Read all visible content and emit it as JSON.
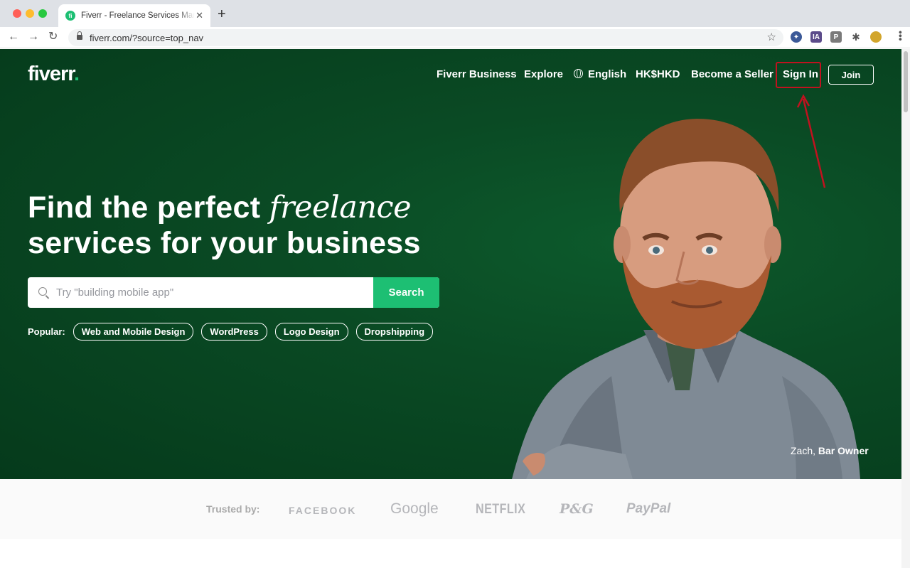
{
  "browser": {
    "tab_title": "Fiverr - Freelance Services Marketplace",
    "tab_favicon": "fi",
    "url": "fiverr.com/?source=top_nav",
    "extensions": [
      {
        "name": "vpn-extension-icon",
        "label": "",
        "color": "#3b5998"
      },
      {
        "name": "ia-extension-icon",
        "label": "IA",
        "color": "#5b4b8a"
      },
      {
        "name": "p-extension-icon",
        "label": "P",
        "color": "#7a7a7a"
      }
    ]
  },
  "nav": {
    "logo": "fiverr",
    "logo_dot": ".",
    "links": {
      "business": "Fiverr Business",
      "explore": "Explore",
      "language": "English",
      "currency": "HK$HKD",
      "seller": "Become a Seller",
      "signin": "Sign In",
      "join": "Join"
    }
  },
  "hero": {
    "headline_part1": "Find the perfect ",
    "headline_italic": "freelance",
    "headline_line2": "services for your business",
    "search_placeholder": "Try \"building mobile app\"",
    "search_button": "Search",
    "popular_label": "Popular:",
    "popular_tags": [
      "Web and Mobile Design",
      "WordPress",
      "Logo Design",
      "Dropshipping"
    ],
    "caption_name": "Zach,",
    "caption_role": "Bar Owner"
  },
  "trusted": {
    "label": "Trusted by:",
    "brands": [
      "FACEBOOK",
      "Google",
      "NETFLIX",
      "P&G",
      "PayPal"
    ]
  },
  "colors": {
    "brand_green": "#1dbf73",
    "hero_bg": "#0a4a24",
    "highlight_red": "#c1121f"
  }
}
